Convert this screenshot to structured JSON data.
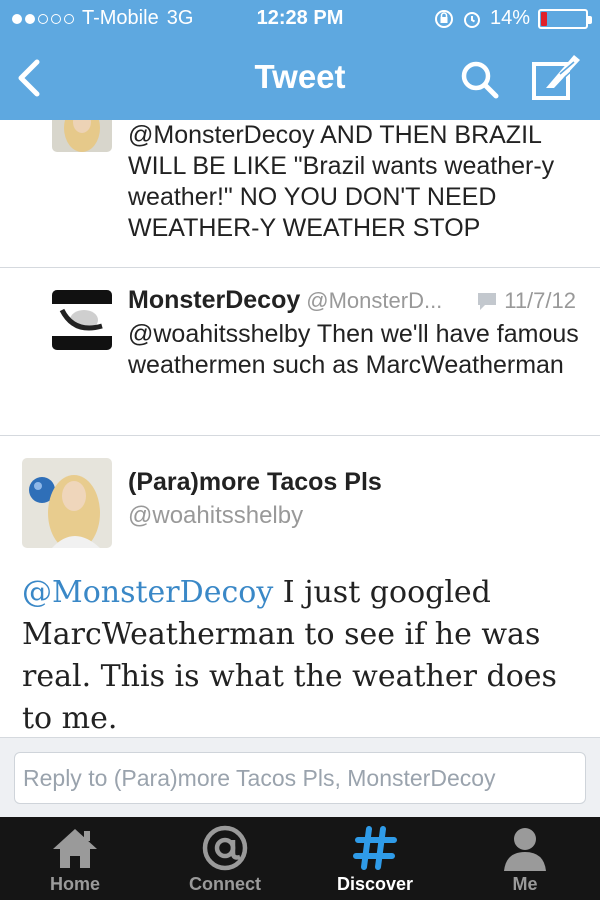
{
  "status_bar": {
    "carrier": "T-Mobile",
    "network": "3G",
    "time": "12:28 PM",
    "battery": "14%",
    "battery_level": 0.14,
    "battery_color": "#e0202a"
  },
  "nav": {
    "title": "Tweet",
    "icons": [
      "back-chevron-icon",
      "search-icon",
      "compose-icon"
    ]
  },
  "tweets": [
    {
      "text": "@MonsterDecoy AND THEN BRAZIL WILL BE LIKE \"Brazil wants weather-y weather!\" NO YOU DON'T NEED WEATHER-Y WEATHER STOP"
    },
    {
      "name": "MonsterDecoy",
      "handle": "@MonsterD...",
      "date": "11/7/12",
      "text": "@woahitsshelby Then we'll have famous weathermen such as MarcWeatherman"
    }
  ],
  "main_tweet": {
    "name": "(Para)more Tacos Pls",
    "handle": "@woahitsshelby",
    "mention": "@MonsterDecoy",
    "text": " I just googled MarcWeatherman to see if he was real. This is what the weather does to me."
  },
  "reply": {
    "placeholder": "Reply to (Para)more Tacos Pls, MonsterDecoy"
  },
  "tabs": [
    {
      "label": "Home",
      "icon": "home-icon",
      "active": false
    },
    {
      "label": "Connect",
      "icon": "at-icon",
      "active": false
    },
    {
      "label": "Discover",
      "icon": "hashtag-icon",
      "active": true
    },
    {
      "label": "Me",
      "icon": "person-icon",
      "active": false
    }
  ],
  "colors": {
    "header_bg": "#5ea8e0",
    "mention": "#3a88c7",
    "tab_active_icon": "#2f9be8",
    "tabbar_bg": "#151515"
  }
}
